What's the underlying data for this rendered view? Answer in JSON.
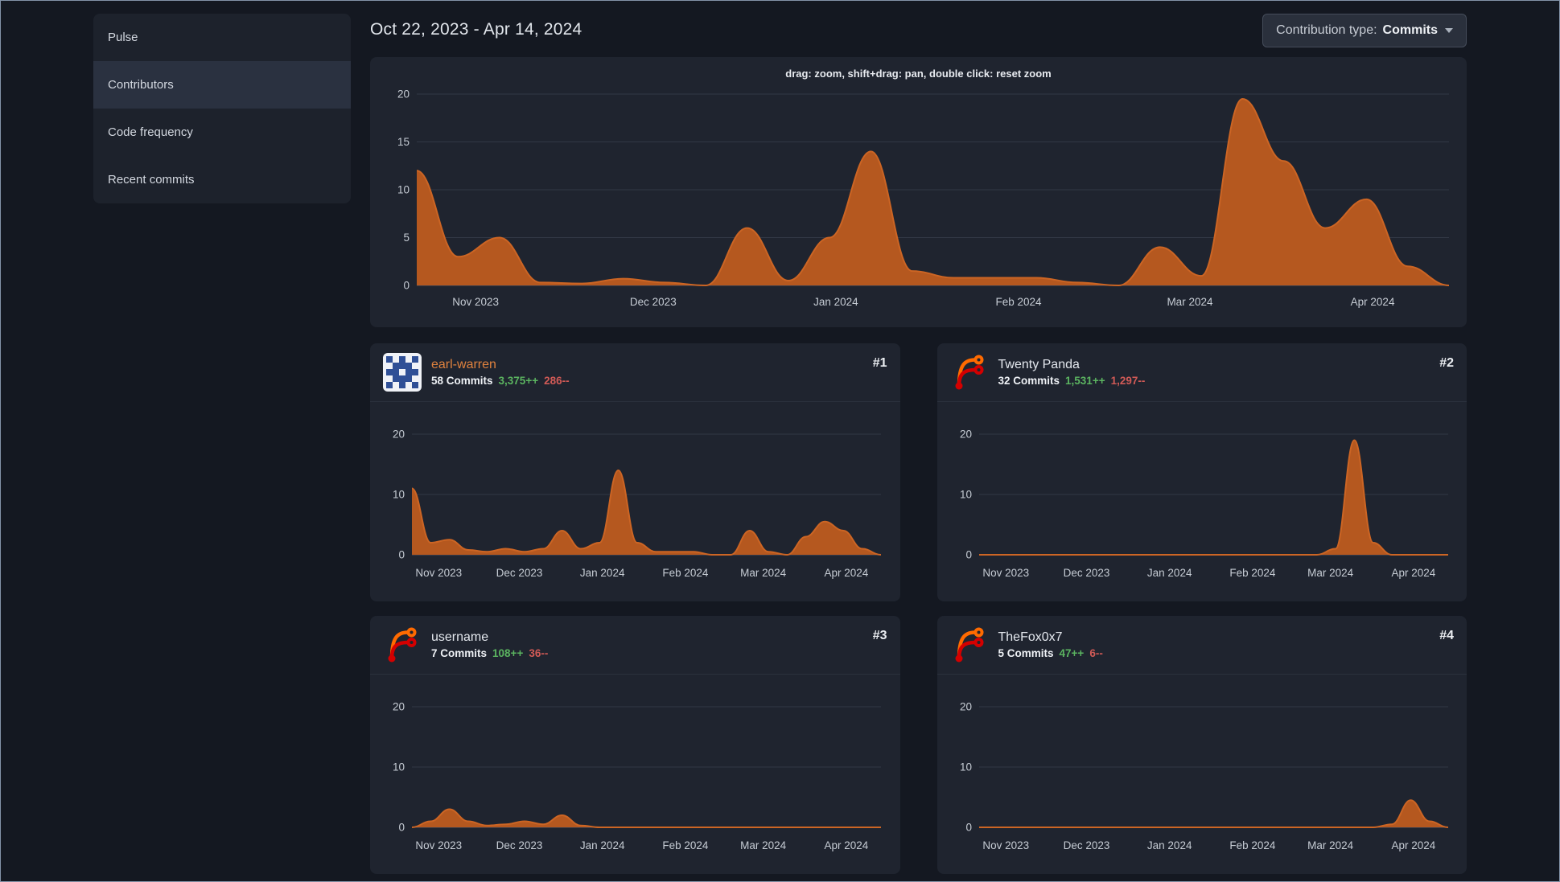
{
  "page": {
    "date_range": "Oct 22, 2023 - Apr 14, 2024",
    "contribution_type": {
      "label": "Contribution type:",
      "value": "Commits"
    }
  },
  "sidebar": {
    "items": [
      {
        "label": "Pulse",
        "active": false
      },
      {
        "label": "Contributors",
        "active": true
      },
      {
        "label": "Code frequency",
        "active": false
      },
      {
        "label": "Recent commits",
        "active": false
      }
    ]
  },
  "contributors": [
    {
      "rank": "#1",
      "name": "earl-warren",
      "commits": "58 Commits",
      "additions": "3,375++",
      "deletions": "286--",
      "avatar": "identicon",
      "is_link": true
    },
    {
      "rank": "#2",
      "name": "Twenty Panda",
      "commits": "32 Commits",
      "additions": "1,531++",
      "deletions": "1,297--",
      "avatar": "forgejo",
      "is_link": false
    },
    {
      "rank": "#3",
      "name": "username",
      "commits": "7 Commits",
      "additions": "108++",
      "deletions": "36--",
      "avatar": "forgejo",
      "is_link": false
    },
    {
      "rank": "#4",
      "name": "TheFox0x7",
      "commits": "5 Commits",
      "additions": "47++",
      "deletions": "6--",
      "avatar": "forgejo",
      "is_link": false
    }
  ],
  "colors": {
    "page_bg": "#141821",
    "card_bg": "#1f242f",
    "chart_fill": "#b5581f",
    "chart_stroke": "#cc6524",
    "grid_line": "#323845",
    "zero_line": "#4d5565",
    "axis_text": "#c6ccd4",
    "link_orange": "#e0823e",
    "green": "#5bb460",
    "red": "#d05a56"
  },
  "chart_data": [
    {
      "id": "all-contributors-commits",
      "type": "area",
      "annotation": "drag: zoom, shift+drag: pan, double click: reset zoom",
      "unit": "commits per week",
      "x_range": [
        "Oct 22, 2023",
        "Apr 14, 2024"
      ],
      "x_tick_labels": [
        "Nov 2023",
        "Dec 2023",
        "Jan 2024",
        "Feb 2024",
        "Mar 2024",
        "Apr 2024"
      ],
      "x_tick_fractions": [
        0.057,
        0.229,
        0.406,
        0.583,
        0.749,
        0.926
      ],
      "y_ticks": [
        0,
        5,
        10,
        15,
        20
      ],
      "ylim": [
        0,
        20
      ],
      "values_weekly": [
        12,
        3,
        5,
        0.3,
        0.2,
        0.7,
        0.3,
        0,
        6,
        0.5,
        5,
        14,
        1.5,
        0.8,
        0.8,
        0.8,
        0.3,
        0,
        4,
        1,
        19.5,
        13,
        6,
        9,
        2,
        0
      ]
    },
    {
      "id": "earl-warren-commits",
      "type": "area",
      "unit": "commits per week",
      "x_range": [
        "Oct 22, 2023",
        "Apr 14, 2024"
      ],
      "x_tick_labels": [
        "Nov 2023",
        "Dec 2023",
        "Jan 2024",
        "Feb 2024",
        "Mar 2024",
        "Apr 2024"
      ],
      "x_tick_fractions": [
        0.057,
        0.229,
        0.406,
        0.583,
        0.749,
        0.926
      ],
      "y_ticks": [
        0,
        10,
        20
      ],
      "ylim": [
        0,
        20
      ],
      "values_weekly": [
        11,
        2,
        2.5,
        0.8,
        0.5,
        1,
        0.5,
        1,
        4,
        1,
        2,
        14,
        2,
        0.5,
        0.5,
        0.5,
        0,
        0,
        4,
        0.5,
        0,
        3,
        5.5,
        4,
        1,
        0
      ]
    },
    {
      "id": "twenty-panda-commits",
      "type": "area",
      "unit": "commits per week",
      "x_range": [
        "Oct 22, 2023",
        "Apr 14, 2024"
      ],
      "x_tick_labels": [
        "Nov 2023",
        "Dec 2023",
        "Jan 2024",
        "Feb 2024",
        "Mar 2024",
        "Apr 2024"
      ],
      "x_tick_fractions": [
        0.057,
        0.229,
        0.406,
        0.583,
        0.749,
        0.926
      ],
      "y_ticks": [
        0,
        10,
        20
      ],
      "ylim": [
        0,
        20
      ],
      "values_weekly": [
        0,
        0,
        0,
        0,
        0,
        0,
        0,
        0,
        0,
        0,
        0,
        0,
        0,
        0,
        0,
        0,
        0,
        0,
        0,
        1,
        19,
        2,
        0,
        0,
        0,
        0
      ]
    },
    {
      "id": "username-commits",
      "type": "area",
      "unit": "commits per week",
      "x_range": [
        "Oct 22, 2023",
        "Apr 14, 2024"
      ],
      "x_tick_labels": [
        "Nov 2023",
        "Dec 2023",
        "Jan 2024",
        "Feb 2024",
        "Mar 2024",
        "Apr 2024"
      ],
      "x_tick_fractions": [
        0.057,
        0.229,
        0.406,
        0.583,
        0.749,
        0.926
      ],
      "y_ticks": [
        0,
        10,
        20
      ],
      "ylim": [
        0,
        20
      ],
      "values_weekly": [
        0,
        1,
        3,
        1,
        0.3,
        0.5,
        1,
        0.5,
        2,
        0.3,
        0,
        0,
        0,
        0,
        0,
        0,
        0,
        0,
        0,
        0,
        0,
        0,
        0,
        0,
        0,
        0
      ]
    },
    {
      "id": "thefox0x7-commits",
      "type": "area",
      "unit": "commits per week",
      "x_range": [
        "Oct 22, 2023",
        "Apr 14, 2024"
      ],
      "x_tick_labels": [
        "Nov 2023",
        "Dec 2023",
        "Jan 2024",
        "Feb 2024",
        "Mar 2024",
        "Apr 2024"
      ],
      "x_tick_fractions": [
        0.057,
        0.229,
        0.406,
        0.583,
        0.749,
        0.926
      ],
      "y_ticks": [
        0,
        10,
        20
      ],
      "ylim": [
        0,
        20
      ],
      "values_weekly": [
        0,
        0,
        0,
        0,
        0,
        0,
        0,
        0,
        0,
        0,
        0,
        0,
        0,
        0,
        0,
        0,
        0,
        0,
        0,
        0,
        0,
        0,
        0.5,
        4.5,
        1,
        0
      ]
    }
  ]
}
